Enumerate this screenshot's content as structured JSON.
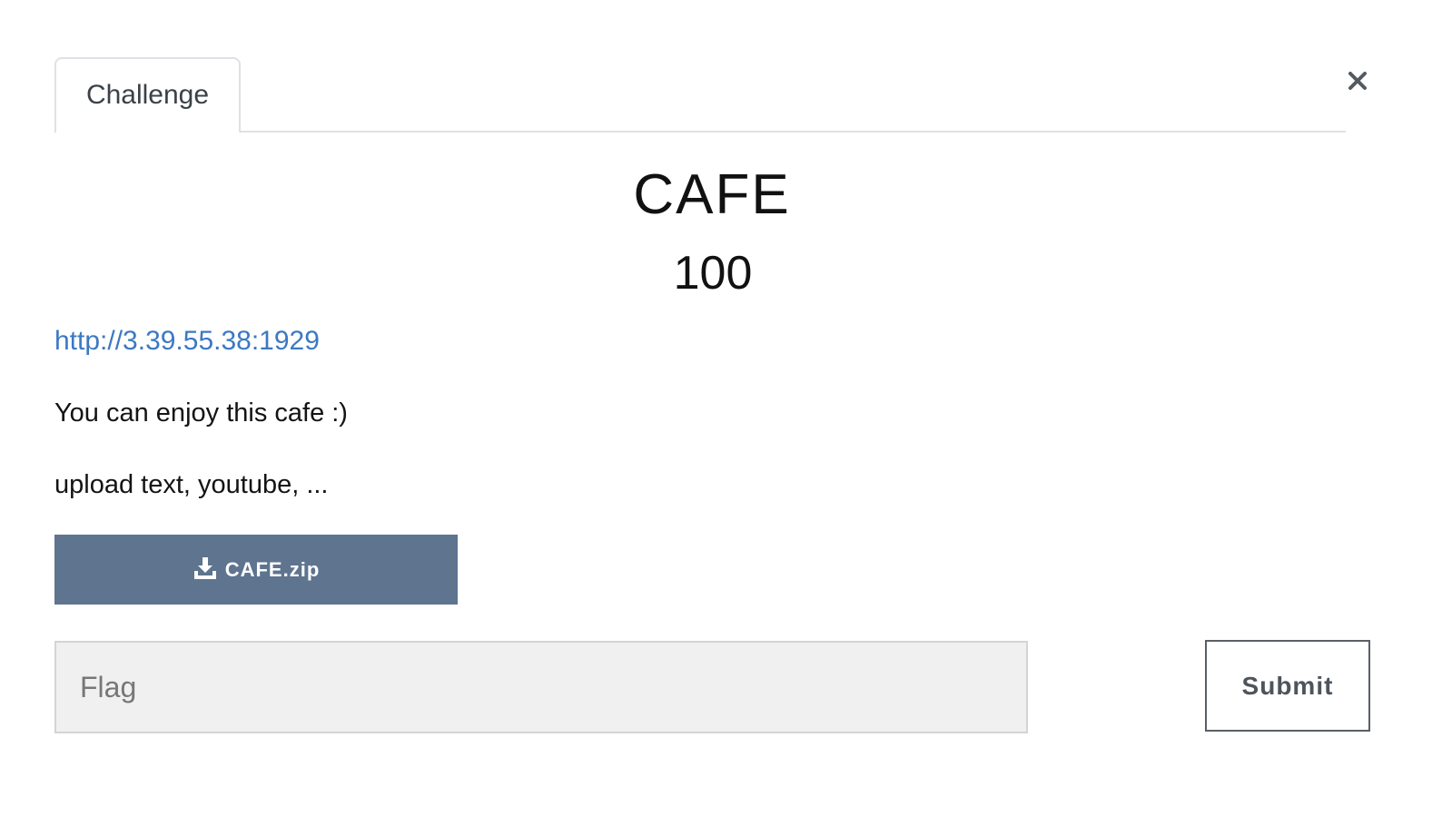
{
  "tabs": [
    {
      "label": "Challenge",
      "active": true
    }
  ],
  "challenge": {
    "name": "CAFE",
    "value": "100",
    "link": "http://3.39.55.38:1929",
    "description": [
      "You can enjoy this cafe :)",
      "upload text, youtube, ..."
    ],
    "file": {
      "label": "CAFE.zip",
      "icon": "download-icon"
    }
  },
  "form": {
    "flag_placeholder": "Flag",
    "flag_value": "",
    "submit_label": "Submit"
  },
  "icons": {
    "close": "close-icon"
  },
  "colors": {
    "link": "#3c79c2",
    "download_button": "#5e748f",
    "input_background": "#f0f0f0"
  }
}
